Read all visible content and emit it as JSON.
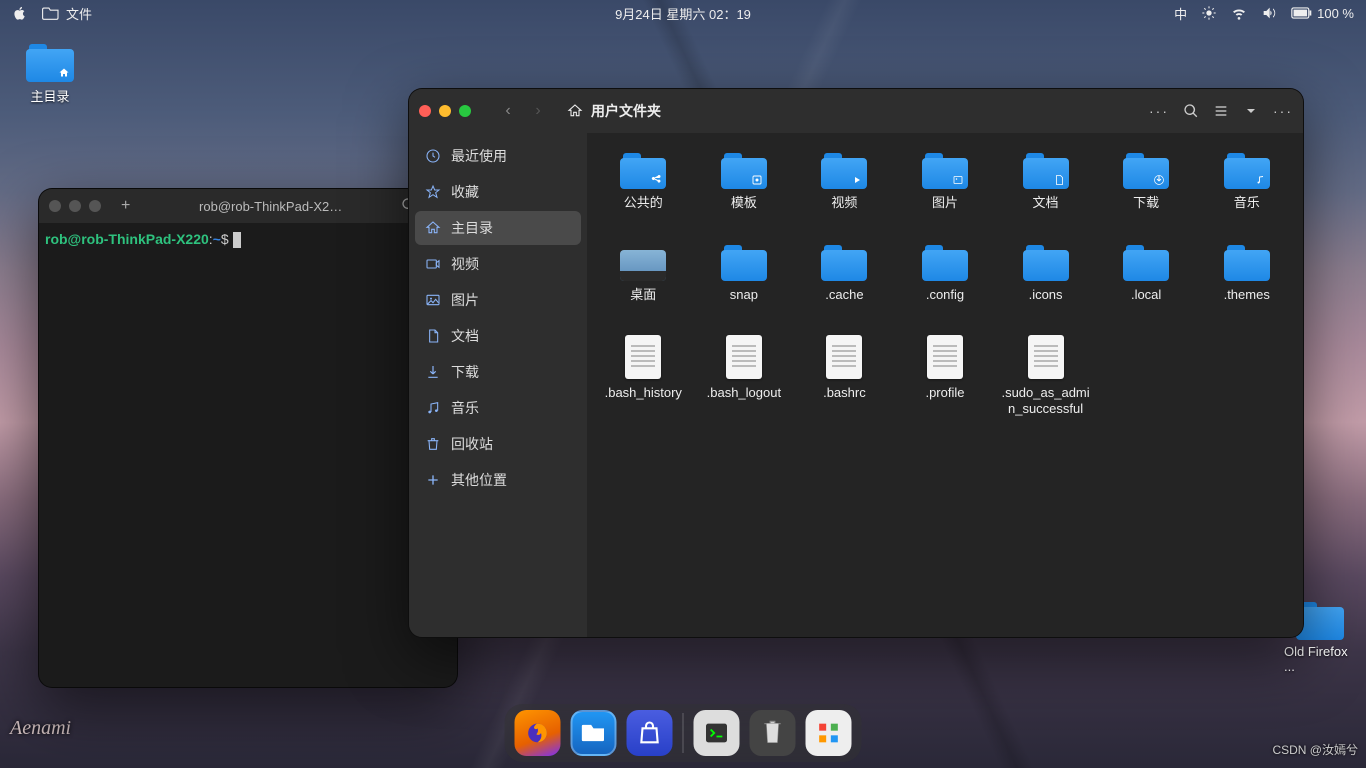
{
  "menubar": {
    "app_menu": "文件",
    "datetime": "9月24日 星期六  02：19",
    "input_method": "中",
    "battery": "100 %"
  },
  "desktop": {
    "home_label": "主目录",
    "firefox_label": "Old Firefox ..."
  },
  "terminal": {
    "tab_title": "rob@rob-ThinkPad-X2…",
    "prompt_user_host": "rob@rob-ThinkPad-X220",
    "prompt_sep": ":",
    "prompt_path": "~",
    "prompt_symbol": "$"
  },
  "files": {
    "title": "用户文件夹",
    "sidebar": [
      {
        "key": "recent",
        "label": "最近使用",
        "icon": "clock"
      },
      {
        "key": "starred",
        "label": "收藏",
        "icon": "star"
      },
      {
        "key": "home",
        "label": "主目录",
        "icon": "home",
        "active": true
      },
      {
        "key": "videos",
        "label": "视频",
        "icon": "video"
      },
      {
        "key": "pictures",
        "label": "图片",
        "icon": "image"
      },
      {
        "key": "documents",
        "label": "文档",
        "icon": "doc"
      },
      {
        "key": "downloads",
        "label": "下载",
        "icon": "down"
      },
      {
        "key": "music",
        "label": "音乐",
        "icon": "music"
      },
      {
        "key": "trash",
        "label": "回收站",
        "icon": "trash"
      },
      {
        "key": "other",
        "label": "其他位置",
        "icon": "plus",
        "muted": true
      }
    ],
    "items": [
      {
        "label": "公共的",
        "type": "folder",
        "badge": "share"
      },
      {
        "label": "模板",
        "type": "folder",
        "badge": "template"
      },
      {
        "label": "视频",
        "type": "folder",
        "badge": "video"
      },
      {
        "label": "图片",
        "type": "folder",
        "badge": "image"
      },
      {
        "label": "文档",
        "type": "folder",
        "badge": "doc"
      },
      {
        "label": "下载",
        "type": "folder",
        "badge": "down"
      },
      {
        "label": "音乐",
        "type": "folder",
        "badge": "music"
      },
      {
        "label": "桌面",
        "type": "desktop"
      },
      {
        "label": "snap",
        "type": "folder"
      },
      {
        "label": ".cache",
        "type": "folder"
      },
      {
        "label": ".config",
        "type": "folder"
      },
      {
        "label": ".icons",
        "type": "folder"
      },
      {
        "label": ".local",
        "type": "folder"
      },
      {
        "label": ".themes",
        "type": "folder"
      },
      {
        "label": ".bash_history",
        "type": "file"
      },
      {
        "label": ".bash_logout",
        "type": "file"
      },
      {
        "label": ".bashrc",
        "type": "file"
      },
      {
        "label": ".profile",
        "type": "file"
      },
      {
        "label": ".sudo_as_admin_successful",
        "type": "file"
      }
    ]
  },
  "signature": "Aenami",
  "watermark": "CSDN @汝嫣兮"
}
